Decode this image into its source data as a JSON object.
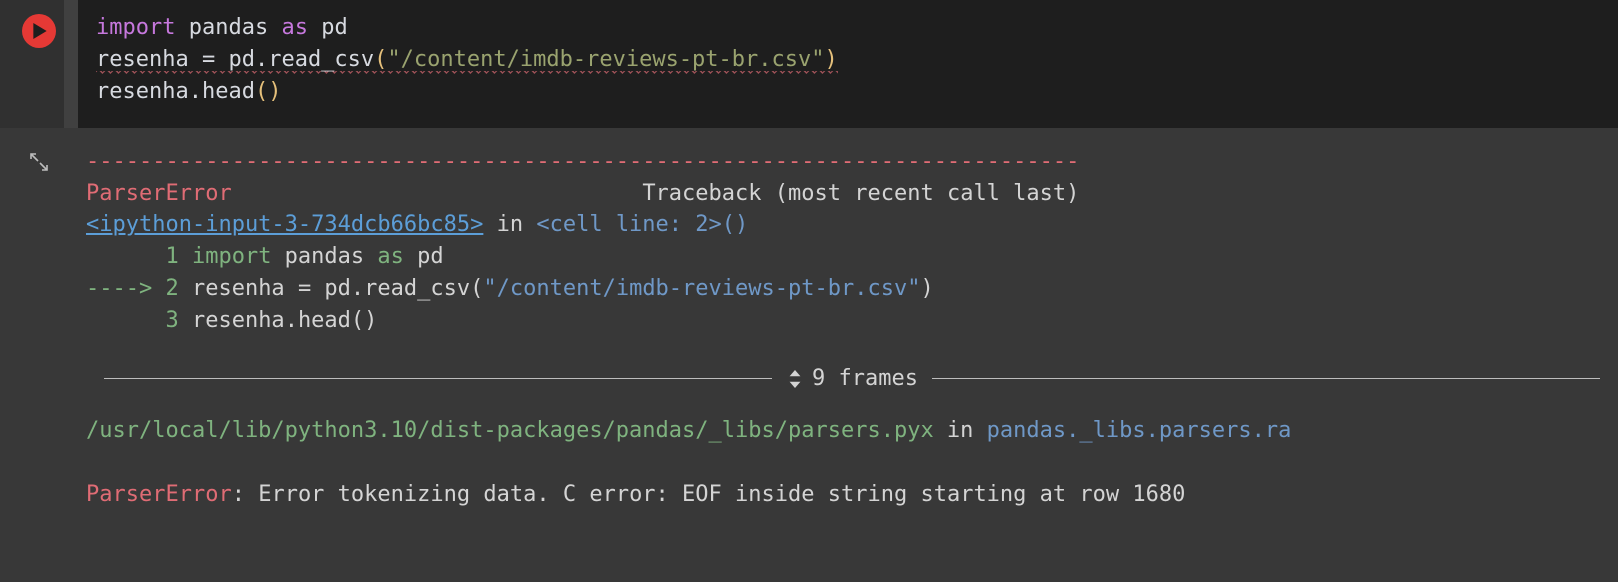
{
  "input": {
    "line1": {
      "kw": "import",
      "mod": "pandas",
      "as": "as",
      "alias": "pd"
    },
    "line2": {
      "var": "resenha",
      "eq": " = ",
      "call": "pd.read_csv",
      "lp": "(",
      "str": "\"/content/imdb-reviews-pt-br.csv\"",
      "rp": ")"
    },
    "line3": {
      "var": "resenha",
      "dot": ".",
      "fn": "head",
      "lp": "(",
      "rp": ")"
    }
  },
  "output": {
    "separator": "---------------------------------------------------------------------------",
    "error_name": "ParserError",
    "traceback_label": "Traceback (most recent call last)",
    "frame_link": "<ipython-input-3-734dcb66bc85>",
    "frame_in": " in ",
    "frame_cell": "<cell line: 2>",
    "frame_paren": "()",
    "src": {
      "l1_num": "      1",
      "l1_import": " import",
      "l1_mod": " pandas",
      "l1_as": " as",
      "l1_pd": " pd",
      "l2_arrow": "----> 2",
      "l2_var": " resenha ",
      "l2_eq": "=",
      "l2_call": " pd.read_csv(",
      "l2_str": "\"/content/imdb-reviews-pt-br.csv\"",
      "l2_rp": ")",
      "l3_num": "      3",
      "l3_var": " resenha",
      "l3_dot": ".",
      "l3_fn": "head()"
    },
    "frames_count": "9 frames",
    "path": "/usr/local/lib/python3.10/dist-packages/pandas/_libs/parsers.pyx",
    "path_in": " in ",
    "path_fn": "pandas._libs.parsers.ra",
    "final_error": "ParserError",
    "final_colon": ": ",
    "final_msg": "Error tokenizing data. C error: EOF inside string starting at row 1680"
  }
}
